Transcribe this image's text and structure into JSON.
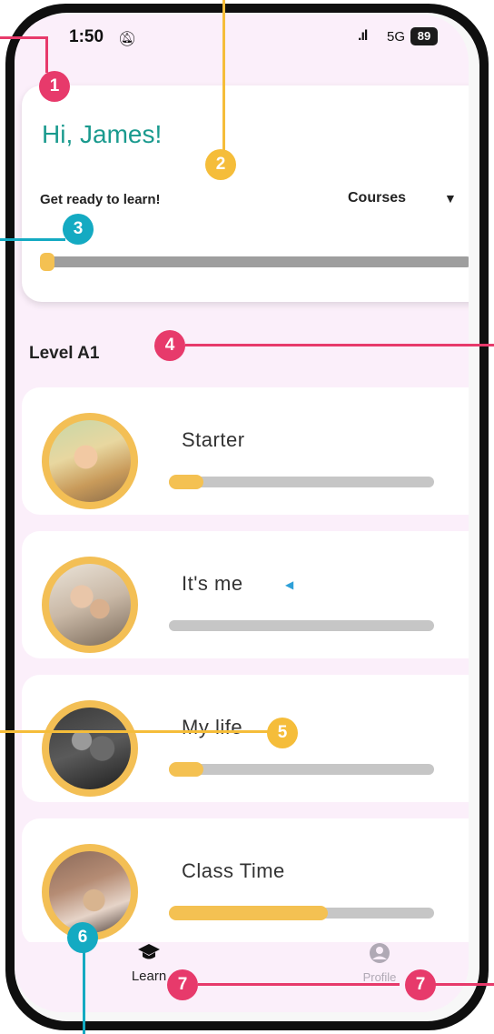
{
  "status_bar": {
    "time": "1:50",
    "network": "5G",
    "battery": "89"
  },
  "header": {
    "greeting": "Hi, James!",
    "subtitle": "Get ready to learn!",
    "course_select": "Courses",
    "overall_progress": 0.02
  },
  "level": {
    "title": "Level A1"
  },
  "lessons": [
    {
      "name": "Starter",
      "progress": 0.13
    },
    {
      "name": "It's me",
      "progress": 0.0
    },
    {
      "name": "My life",
      "progress": 0.13
    },
    {
      "name": "Class Time",
      "progress": 0.6
    }
  ],
  "nav": {
    "learn_label": "Learn",
    "profile_label": "Profile"
  },
  "annotations": [
    "1",
    "2",
    "3",
    "4",
    "5",
    "6",
    "7",
    "7"
  ],
  "colors": {
    "accent": "#f4c152",
    "greeting": "#1a9a8e",
    "badge_pink": "#e73a6b",
    "badge_gold": "#f5bd3a",
    "badge_teal": "#14aac2"
  }
}
